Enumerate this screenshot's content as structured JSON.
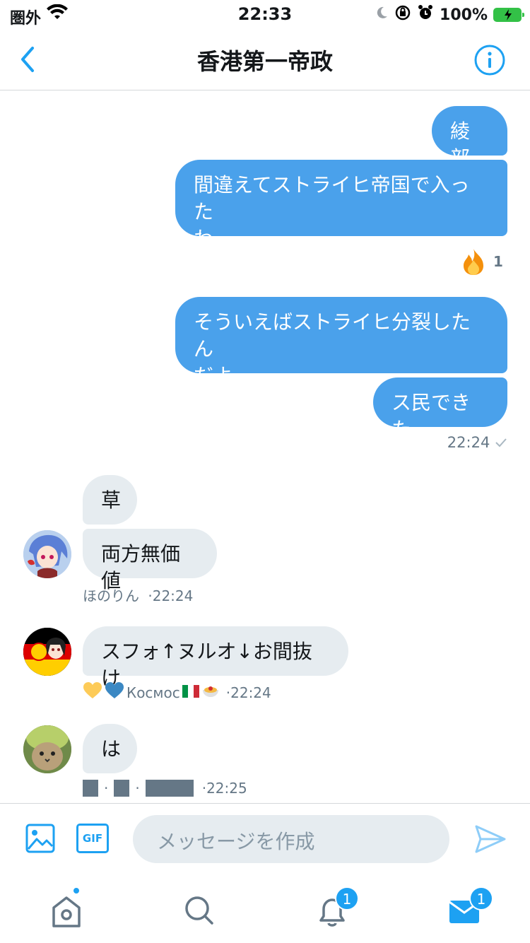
{
  "status_bar": {
    "carrier": "圏外",
    "time": "22:33",
    "battery": "100%"
  },
  "header": {
    "title": "香港第一帝政"
  },
  "messages_out": [
    {
      "text": "綾部"
    },
    {
      "text": "間違えてストライヒ帝国で入った",
      "text2": "わ",
      "reaction_count": "1"
    },
    {
      "text": "そういえばストライヒ分裂したん",
      "text2": "だよ"
    },
    {
      "text": "ス民できた",
      "time": "22:24"
    }
  ],
  "messages_in": [
    {
      "text": "草"
    },
    {
      "text": "両方無価値",
      "sender": "ほのりん",
      "time": "·22:24"
    },
    {
      "text": "スフォ↑ヌルオ↓お間抜け",
      "sender": "Космос",
      "time": "·22:24"
    },
    {
      "text": "は",
      "time": "·22:25"
    }
  ],
  "compose": {
    "placeholder": "メッセージを作成",
    "gif_label": "GIF"
  },
  "tabbar": {
    "notifications_badge": "1",
    "messages_badge": "1"
  },
  "colors": {
    "accent": "#1da1f2",
    "outgoing_bubble": "#4aa1eb",
    "incoming_bubble": "#e6ecf0"
  }
}
